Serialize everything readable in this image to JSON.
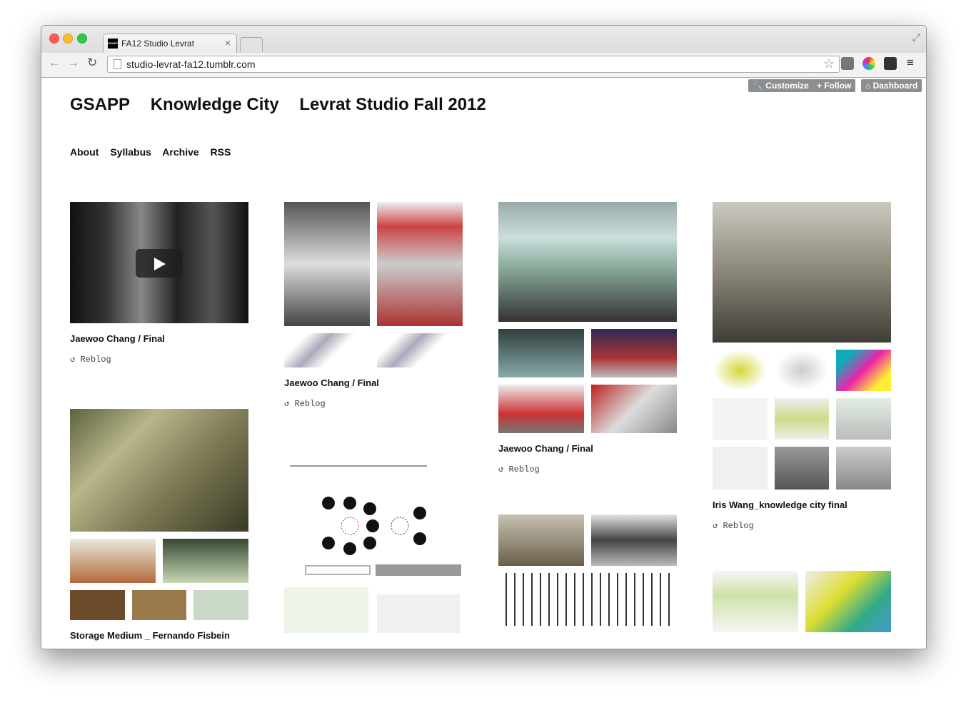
{
  "browser": {
    "tab_title": "FA12 Studio Levrat",
    "favicon_text": "GSAPP",
    "url": "studio-levrat-fa12.tumblr.com"
  },
  "tumblr_controls": {
    "customize": "Customize",
    "follow": "Follow",
    "dashboard": "Dashboard"
  },
  "site": {
    "brand": "GSAPP",
    "title": "Knowledge City",
    "subtitle": "Levrat Studio Fall 2012"
  },
  "nav": [
    "About",
    "Syllabus",
    "Archive",
    "RSS"
  ],
  "posts": {
    "col1": [
      {
        "title": "Jaewoo Chang / Final",
        "reblog": "Reblog"
      },
      {
        "title": "Storage Medium _ Fernando Fisbein"
      }
    ],
    "col2": [
      {
        "title": "Jaewoo Chang / Final",
        "reblog": "Reblog"
      }
    ],
    "col3": [
      {
        "title": "Jaewoo Chang / Final",
        "reblog": "Reblog"
      }
    ],
    "col4": [
      {
        "title": "Iris Wang_knowledge city final",
        "reblog": "Reblog"
      }
    ]
  },
  "icons": {
    "reblog": "reblog-icon",
    "play": "play-icon"
  }
}
